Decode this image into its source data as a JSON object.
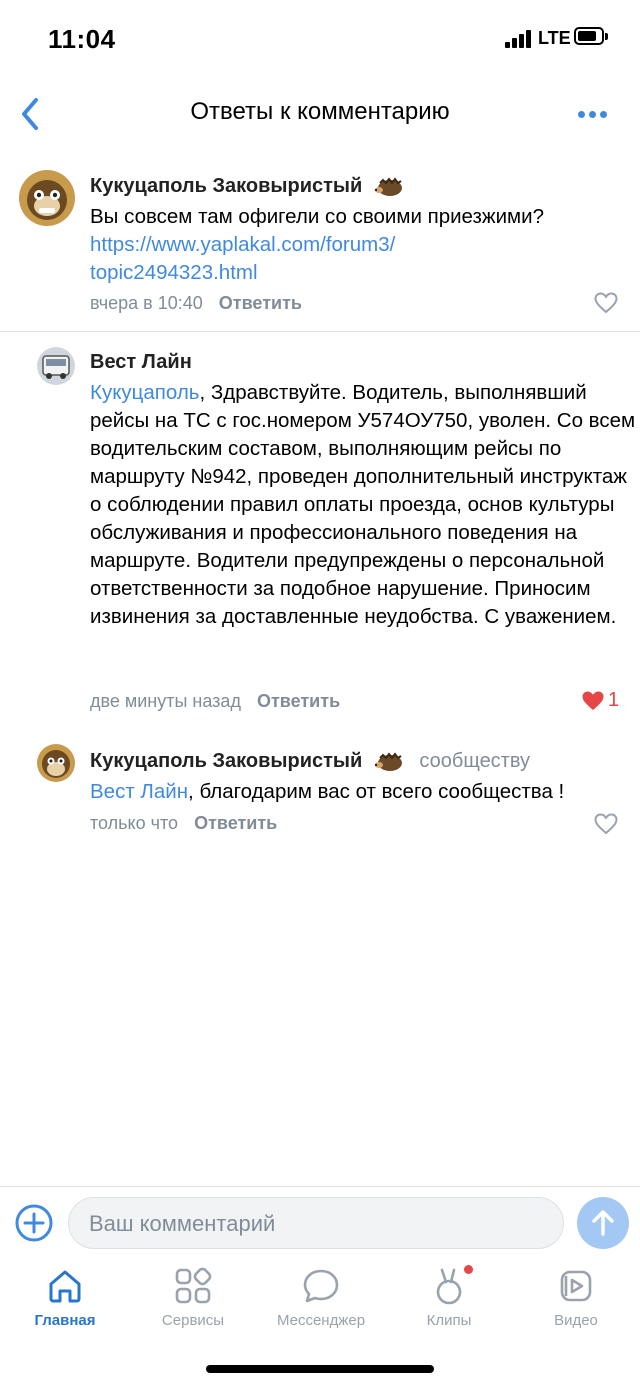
{
  "status_bar": {
    "time": "11:04",
    "network": "LTE"
  },
  "header": {
    "title": "Ответы к комментарию"
  },
  "comments": [
    {
      "author": "Кукуцаполь Заковыристый",
      "text": "Вы совсем там офигели со своими приезжими?",
      "link": "https://www.yaplakal.com/forum3/topic2494323.html",
      "link_line1": "https://www.yaplakal.com/forum3/",
      "link_line2": "topic2494323.html",
      "time": "вчера в 10:40",
      "reply_label": "Ответить"
    },
    {
      "author": "Вест Лайн",
      "mention": "Кукуцаполь",
      "text": ", Здравствуйте. Водитель, выполнявший рейсы на ТС с гос.номером У574ОУ750, уволен. Со всем водительским составом, выполняющим рейсы по маршруту №942, проведен дополнительный инструктаж о соблюдении правил оплаты проезда, основ культуры обслуживания и профессионального поведения на маршруте. Водители предупреждены о персональной ответственности за подобное нарушение. Приносим извинения за доставленные неудобства. С уважением.",
      "time": "две минуты назад",
      "reply_label": "Ответить",
      "likes": "1",
      "liked": true
    },
    {
      "author": "Кукуцаполь Заковыристый",
      "to_label": "сообществу",
      "mention": "Вест Лайн",
      "text": ", благодарим вас от всего сообщества !",
      "time": "только что",
      "reply_label": "Ответить"
    }
  ],
  "composer": {
    "placeholder": "Ваш комментарий"
  },
  "tabs": [
    {
      "label": "Главная",
      "icon": "home-icon",
      "active": true
    },
    {
      "label": "Сервисы",
      "icon": "services-icon"
    },
    {
      "label": "Мессенджер",
      "icon": "messenger-icon"
    },
    {
      "label": "Клипы",
      "icon": "clips-icon",
      "badge": true
    },
    {
      "label": "Видео",
      "icon": "video-icon"
    }
  ],
  "colors": {
    "accent": "#3f8ae0",
    "link": "#2a5885",
    "like": "#e64646",
    "secondary": "#818c99"
  }
}
